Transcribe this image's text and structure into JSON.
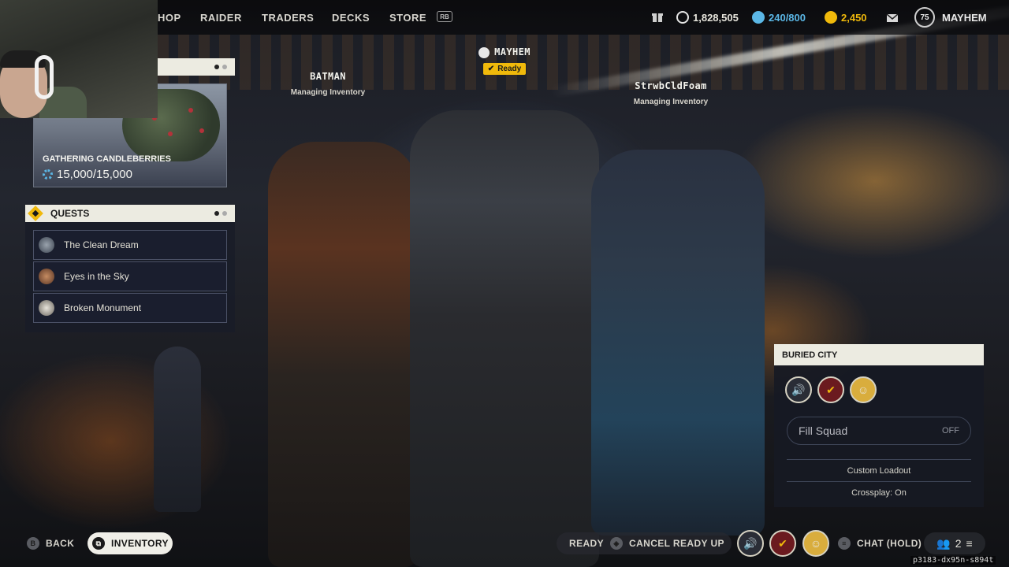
{
  "nav": {
    "items": [
      "HOP",
      "RAIDER",
      "TRADERS",
      "DECKS",
      "STORE"
    ],
    "rb_hint": "RB"
  },
  "currencies": {
    "credits": "1,828,505",
    "tokens": "240/800",
    "coins": "2,450",
    "level": "75",
    "username": "MAYHEM"
  },
  "event": {
    "title": "GATHERING CANDLEBERRIES",
    "progress": "15,000/15,000"
  },
  "quests": {
    "header": "QUESTS",
    "items": [
      {
        "label": "The Clean Dream",
        "icon": "quest-portrait-icon"
      },
      {
        "label": "Eyes in the Sky",
        "icon": "quest-portrait-icon"
      },
      {
        "label": "Broken Monument",
        "icon": "quest-portrait-icon"
      }
    ]
  },
  "players": [
    {
      "name": "BATMAN",
      "status": "Managing Inventory"
    },
    {
      "name": "MAYHEM",
      "status": "Ready"
    },
    {
      "name": "StrwbCldFoam",
      "status": "Managing Inventory"
    }
  ],
  "lobby": {
    "map_name": "BURIED CITY",
    "fill_squad_label": "Fill Squad",
    "fill_squad_value": "OFF",
    "custom_loadout": "Custom Loadout",
    "crossplay": "Crossplay: On"
  },
  "bottom": {
    "back_key": "B",
    "back_label": "BACK",
    "inventory_label": "INVENTORY",
    "ready_label": "READY",
    "cancel_ready_label": "CANCEL READY UP",
    "chat_label": "CHAT (HOLD)",
    "squad_count": "2",
    "session_id": "p3183-dx95n-s894t"
  },
  "colors": {
    "accent_yellow": "#f0b90b",
    "panel_header": "#ecebe1",
    "token_blue": "#5bb7e6"
  }
}
